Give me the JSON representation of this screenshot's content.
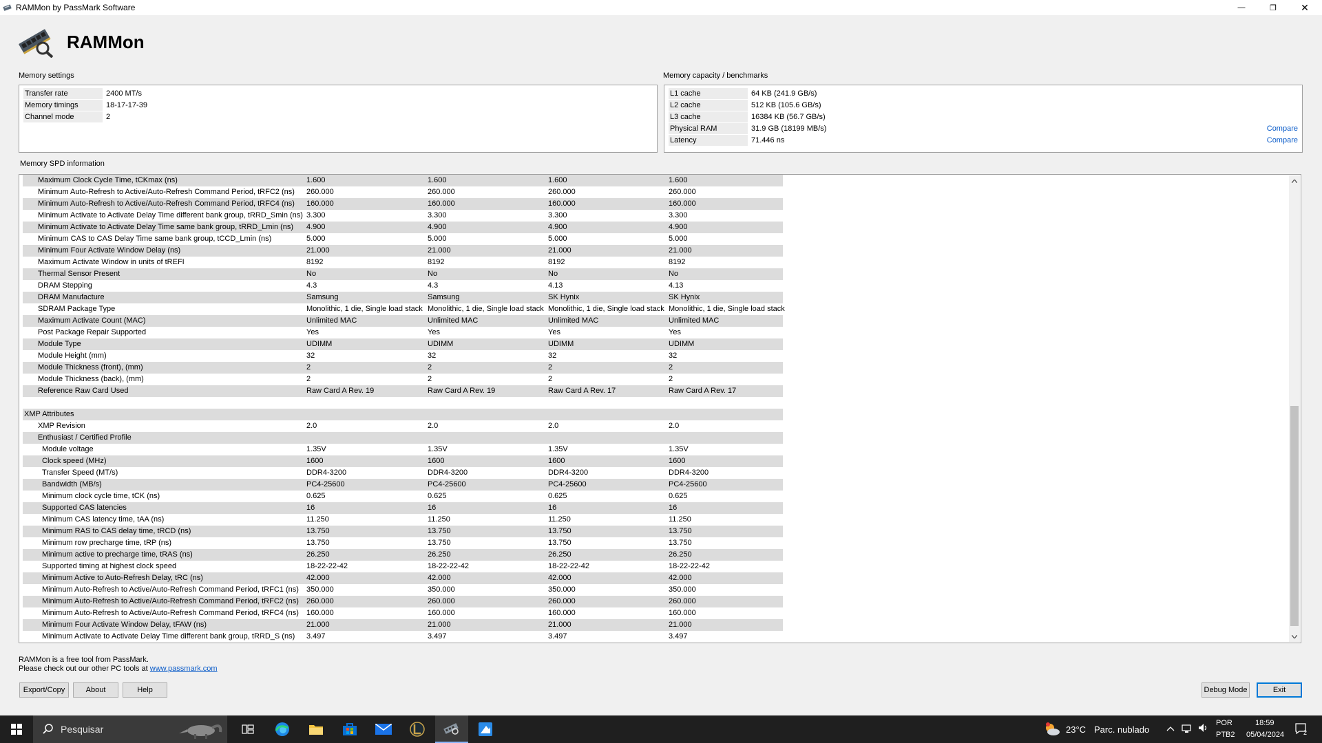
{
  "window": {
    "title": "RAMMon by PassMark Software",
    "minimize_glyph": "—",
    "maximize_glyph": "❐",
    "close_glyph": "✕"
  },
  "header": {
    "app_name": "RAMMon"
  },
  "memory_settings": {
    "label": "Memory settings",
    "rows": [
      {
        "key": "Transfer rate",
        "value": "2400 MT/s"
      },
      {
        "key": "Memory timings",
        "value": "18-17-17-39"
      },
      {
        "key": "Channel mode",
        "value": "2"
      }
    ]
  },
  "capacity": {
    "label": "Memory capacity / benchmarks",
    "rows": [
      {
        "key": "L1 cache",
        "value": "64 KB (241.9 GB/s)"
      },
      {
        "key": "L2 cache",
        "value": "512 KB (105.6 GB/s)"
      },
      {
        "key": "L3 cache",
        "value": "16384 KB (56.7 GB/s)"
      },
      {
        "key": "Physical RAM",
        "value": "31.9 GB (18199 MB/s)"
      },
      {
        "key": "Latency",
        "value": "71.446 ns"
      }
    ],
    "compare_label": "Compare"
  },
  "spd": {
    "label": "Memory SPD information",
    "rows": [
      {
        "indent": 1,
        "label": "Maximum Clock Cycle Time, tCKmax (ns)",
        "values": [
          "1.600",
          "1.600",
          "1.600",
          "1.600"
        ]
      },
      {
        "indent": 1,
        "label": "Minimum Auto-Refresh to Active/Auto-Refresh Command Period, tRFC2 (ns)",
        "values": [
          "260.000",
          "260.000",
          "260.000",
          "260.000"
        ]
      },
      {
        "indent": 1,
        "label": "Minimum Auto-Refresh to Active/Auto-Refresh Command Period, tRFC4 (ns)",
        "values": [
          "160.000",
          "160.000",
          "160.000",
          "160.000"
        ]
      },
      {
        "indent": 1,
        "label": "Minimum Activate to Activate Delay Time different bank group, tRRD_Smin (ns)",
        "values": [
          "3.300",
          "3.300",
          "3.300",
          "3.300"
        ]
      },
      {
        "indent": 1,
        "label": "Minimum Activate to Activate Delay Time same bank group, tRRD_Lmin (ns)",
        "values": [
          "4.900",
          "4.900",
          "4.900",
          "4.900"
        ]
      },
      {
        "indent": 1,
        "label": "Minimum CAS to CAS Delay Time same bank group, tCCD_Lmin (ns)",
        "values": [
          "5.000",
          "5.000",
          "5.000",
          "5.000"
        ]
      },
      {
        "indent": 1,
        "label": "Minimum Four Activate Window Delay (ns)",
        "values": [
          "21.000",
          "21.000",
          "21.000",
          "21.000"
        ]
      },
      {
        "indent": 1,
        "label": "Maximum Activate Window in units of tREFI",
        "values": [
          "8192",
          "8192",
          "8192",
          "8192"
        ]
      },
      {
        "indent": 1,
        "label": "Thermal Sensor Present",
        "values": [
          "No",
          "No",
          "No",
          "No"
        ]
      },
      {
        "indent": 1,
        "label": "DRAM Stepping",
        "values": [
          "4.3",
          "4.3",
          "4.13",
          "4.13"
        ]
      },
      {
        "indent": 1,
        "label": "DRAM Manufacture",
        "values": [
          "Samsung",
          "Samsung",
          "SK Hynix",
          "SK Hynix"
        ]
      },
      {
        "indent": 1,
        "label": "SDRAM Package Type",
        "values": [
          "Monolithic, 1 die, Single load stack",
          "Monolithic, 1 die, Single load stack",
          "Monolithic, 1 die, Single load stack",
          "Monolithic, 1 die, Single load stack"
        ]
      },
      {
        "indent": 1,
        "label": "Maximum Activate Count (MAC)",
        "values": [
          "Unlimited MAC",
          "Unlimited MAC",
          "Unlimited MAC",
          "Unlimited MAC"
        ]
      },
      {
        "indent": 1,
        "label": "Post Package Repair Supported",
        "values": [
          "Yes",
          "Yes",
          "Yes",
          "Yes"
        ]
      },
      {
        "indent": 1,
        "label": "Module Type",
        "values": [
          "UDIMM",
          "UDIMM",
          "UDIMM",
          "UDIMM"
        ]
      },
      {
        "indent": 1,
        "label": "Module Height (mm)",
        "values": [
          "32",
          "32",
          "32",
          "32"
        ]
      },
      {
        "indent": 1,
        "label": "Module Thickness (front), (mm)",
        "values": [
          "2",
          "2",
          "2",
          "2"
        ]
      },
      {
        "indent": 1,
        "label": "Module Thickness (back), (mm)",
        "values": [
          "2",
          "2",
          "2",
          "2"
        ]
      },
      {
        "indent": 1,
        "label": "Reference Raw Card Used",
        "values": [
          "Raw Card A Rev. 19",
          "Raw Card A Rev. 19",
          "Raw Card A Rev. 17",
          "Raw Card A Rev. 17"
        ]
      },
      {
        "indent": 0,
        "label": "",
        "values": [
          "",
          "",
          "",
          ""
        ]
      },
      {
        "indent": 0,
        "label": "XMP Attributes",
        "values": [
          "",
          "",
          "",
          ""
        ]
      },
      {
        "indent": 1,
        "label": "XMP Revision",
        "values": [
          "2.0",
          "2.0",
          "2.0",
          "2.0"
        ]
      },
      {
        "indent": 1,
        "label": "Enthusiast / Certified Profile",
        "values": [
          "",
          "",
          "",
          ""
        ]
      },
      {
        "indent": 2,
        "label": "Module voltage",
        "values": [
          "1.35V",
          "1.35V",
          "1.35V",
          "1.35V"
        ]
      },
      {
        "indent": 2,
        "label": "Clock speed (MHz)",
        "values": [
          "1600",
          "1600",
          "1600",
          "1600"
        ]
      },
      {
        "indent": 2,
        "label": "Transfer Speed (MT/s)",
        "values": [
          "DDR4-3200",
          "DDR4-3200",
          "DDR4-3200",
          "DDR4-3200"
        ]
      },
      {
        "indent": 2,
        "label": "Bandwidth (MB/s)",
        "values": [
          "PC4-25600",
          "PC4-25600",
          "PC4-25600",
          "PC4-25600"
        ]
      },
      {
        "indent": 2,
        "label": "Minimum clock cycle time, tCK (ns)",
        "values": [
          "0.625",
          "0.625",
          "0.625",
          "0.625"
        ]
      },
      {
        "indent": 2,
        "label": "Supported CAS latencies",
        "values": [
          "16",
          "16",
          "16",
          "16"
        ]
      },
      {
        "indent": 2,
        "label": "Minimum CAS latency time, tAA (ns)",
        "values": [
          "11.250",
          "11.250",
          "11.250",
          "11.250"
        ]
      },
      {
        "indent": 2,
        "label": "Minimum RAS to CAS delay time, tRCD (ns)",
        "values": [
          "13.750",
          "13.750",
          "13.750",
          "13.750"
        ]
      },
      {
        "indent": 2,
        "label": "Minimum row precharge time, tRP (ns)",
        "values": [
          "13.750",
          "13.750",
          "13.750",
          "13.750"
        ]
      },
      {
        "indent": 2,
        "label": "Minimum active to precharge time, tRAS (ns)",
        "values": [
          "26.250",
          "26.250",
          "26.250",
          "26.250"
        ]
      },
      {
        "indent": 2,
        "label": "Supported timing at highest clock speed",
        "values": [
          "18-22-22-42",
          "18-22-22-42",
          "18-22-22-42",
          "18-22-22-42"
        ]
      },
      {
        "indent": 2,
        "label": "Minimum Active to Auto-Refresh Delay, tRC (ns)",
        "values": [
          "42.000",
          "42.000",
          "42.000",
          "42.000"
        ]
      },
      {
        "indent": 2,
        "label": "Minimum Auto-Refresh to Active/Auto-Refresh Command Period, tRFC1 (ns)",
        "values": [
          "350.000",
          "350.000",
          "350.000",
          "350.000"
        ]
      },
      {
        "indent": 2,
        "label": "Minimum Auto-Refresh to Active/Auto-Refresh Command Period, tRFC2 (ns)",
        "values": [
          "260.000",
          "260.000",
          "260.000",
          "260.000"
        ]
      },
      {
        "indent": 2,
        "label": "Minimum Auto-Refresh to Active/Auto-Refresh Command Period, tRFC4 (ns)",
        "values": [
          "160.000",
          "160.000",
          "160.000",
          "160.000"
        ]
      },
      {
        "indent": 2,
        "label": "Minimum Four Activate Window Delay, tFAW (ns)",
        "values": [
          "21.000",
          "21.000",
          "21.000",
          "21.000"
        ]
      },
      {
        "indent": 2,
        "label": "Minimum Activate to Activate Delay Time different bank group, tRRD_S (ns)",
        "values": [
          "3.497",
          "3.497",
          "3.497",
          "3.497"
        ]
      }
    ]
  },
  "footer": {
    "line1": "RAMMon is a free tool from PassMark.",
    "line2_prefix": "Please check out our other PC tools at ",
    "link": "www.passmark.com",
    "buttons": {
      "export": "Export/Copy",
      "about": "About",
      "help": "Help",
      "debug": "Debug Mode",
      "exit": "Exit"
    }
  },
  "taskbar": {
    "search_placeholder": "Pesquisar",
    "weather_temp": "23°C",
    "weather_text": "Parc. nublado",
    "lang": "POR",
    "lang_sub": "PTB2",
    "time": "18:59",
    "date": "05/04/2024",
    "notifications": "2"
  }
}
